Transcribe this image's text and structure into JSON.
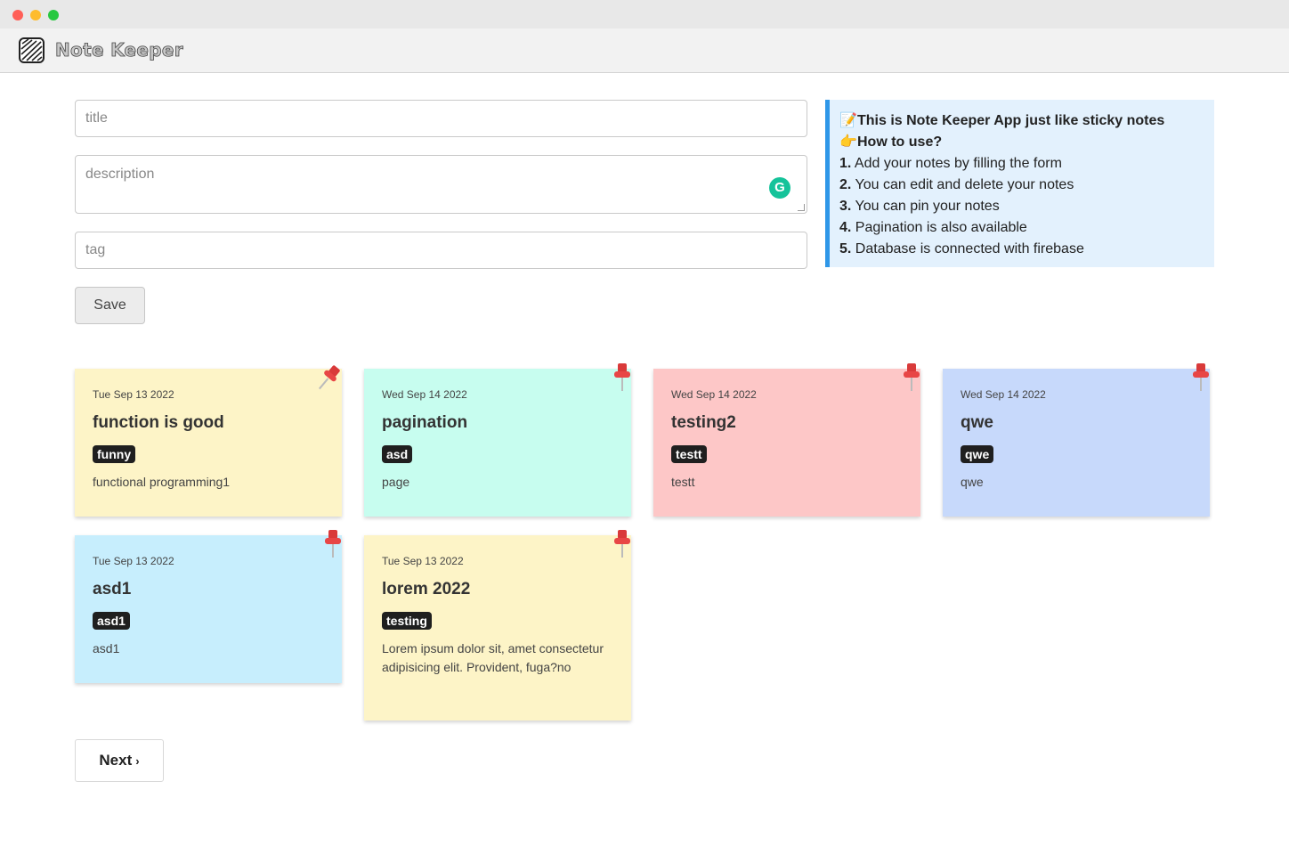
{
  "navbar": {
    "brand": "Note Keeper"
  },
  "form": {
    "title_placeholder": "title",
    "description_placeholder": "description",
    "tag_placeholder": "tag",
    "save_label": "Save"
  },
  "info": {
    "heading1": "This is Note Keeper App just like sticky notes",
    "heading1_emoji": "📝",
    "heading2": "How to use?",
    "heading2_emoji": "👉",
    "steps": [
      {
        "num": "1.",
        "text": "Add your notes by filling the form"
      },
      {
        "num": "2.",
        "text": "You can edit and delete your notes"
      },
      {
        "num": "3.",
        "text": "You can pin your notes"
      },
      {
        "num": "4.",
        "text": "Pagination is also available"
      },
      {
        "num": "5.",
        "text": "Database is connected with firebase"
      }
    ]
  },
  "notes": [
    {
      "date": "Tue Sep 13 2022",
      "title": "function is good",
      "tag": "funny",
      "description": "functional programming1",
      "color": "#fdf4c7",
      "pinned": true
    },
    {
      "date": "Wed Sep 14 2022",
      "title": "pagination",
      "tag": "asd",
      "description": "page",
      "color": "#c7fdef",
      "pinned": false
    },
    {
      "date": "Wed Sep 14 2022",
      "title": "testing2",
      "tag": "testt",
      "description": "testt",
      "color": "#fdc7c7",
      "pinned": false
    },
    {
      "date": "Wed Sep 14 2022",
      "title": "qwe",
      "tag": "qwe",
      "description": "qwe",
      "color": "#c7d9fb",
      "pinned": false
    },
    {
      "date": "Tue Sep 13 2022",
      "title": "asd1",
      "tag": "asd1",
      "description": "asd1",
      "color": "#c7eefd",
      "pinned": false
    },
    {
      "date": "Tue Sep 13 2022",
      "title": "lorem 2022",
      "tag": "testing",
      "description": "Lorem ipsum dolor sit, amet consectetur adipisicing elit. Provident, fuga?no",
      "color": "#fdf4c7",
      "pinned": false
    }
  ],
  "pagination": {
    "next_label": "Next",
    "next_icon": "chevron-right-icon"
  }
}
